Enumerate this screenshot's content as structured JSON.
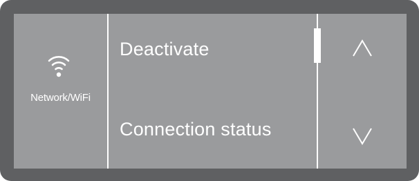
{
  "side_panel": {
    "icon": "wifi-icon",
    "label": "Network/WiFi"
  },
  "menu": {
    "items": [
      {
        "label": "Deactivate"
      },
      {
        "label": "Connection status"
      }
    ]
  },
  "navigation": {
    "up_icon": "chevron-up-icon",
    "down_icon": "chevron-down-icon"
  },
  "colors": {
    "bezel": "#5f6062",
    "screen": "#9a9b9d",
    "foreground": "#ffffff"
  }
}
